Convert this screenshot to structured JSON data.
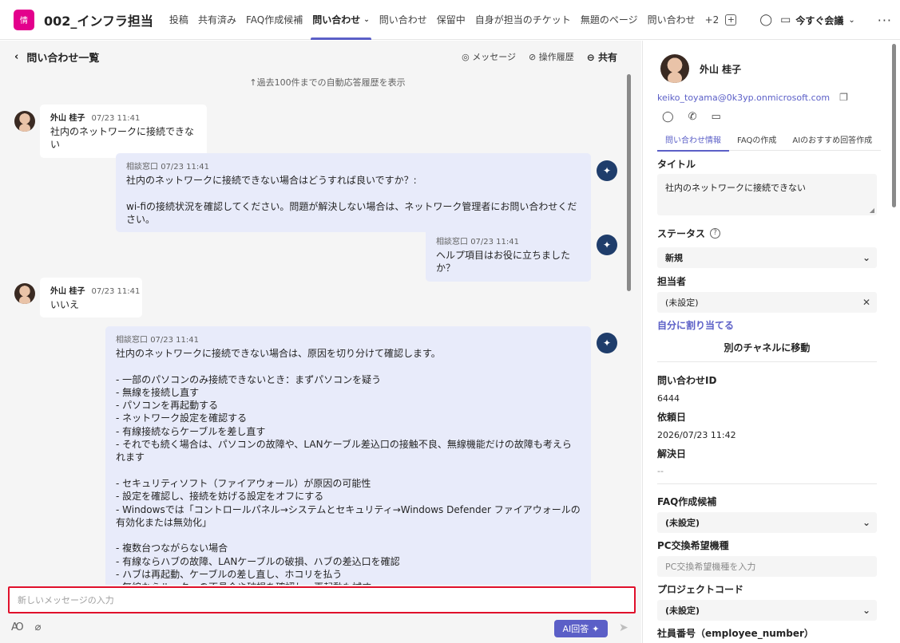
{
  "header": {
    "team_avatar": "情",
    "team_name": "002_インフラ担当",
    "tabs": [
      {
        "label": "投稿"
      },
      {
        "label": "共有済み"
      },
      {
        "label": "FAQ作成候補"
      },
      {
        "label": "問い合わせ",
        "active": true
      },
      {
        "label": "問い合わせ"
      },
      {
        "label": "保留中"
      },
      {
        "label": "自身が担当のチケット"
      },
      {
        "label": "無題のページ"
      },
      {
        "label": "問い合わせ"
      }
    ],
    "overflow_count": "+2",
    "meet_now": "今すぐ会議"
  },
  "chat": {
    "back_label": "問い合わせ一覧",
    "actions": {
      "message": "メッセージ",
      "history": "操作履歴",
      "share": "共有"
    },
    "history_link": "↑過去100件までの自動応答履歴を表示",
    "messages": [
      {
        "sender": "外山 桂子",
        "time": "07/23 11:41",
        "text": "社内のネットワークに接続できない"
      },
      {
        "sender": "相談窓口",
        "time": "07/23 11:41",
        "text": "社内のネットワークに接続できない場合はどうすれば良いですか？:\n\nwi-fiの接続状況を確認してください。問題が解決しない場合は、ネットワーク管理者にお問い合わせください。"
      },
      {
        "sender": "相談窓口",
        "time": "07/23 11:41",
        "text": "ヘルプ項目はお役に立ちましたか？"
      },
      {
        "sender": "外山 桂子",
        "time": "07/23 11:41",
        "text": "いいえ"
      },
      {
        "sender": "相談窓口",
        "time": "07/23 11:41",
        "text": "社内のネットワークに接続できない場合は、原因を切り分けて確認します。\n\n- 一部のパソコンのみ接続できないとき：まずパソコンを疑う\n- 無線を接続し直す\n- パソコンを再起動する\n- ネットワーク設定を確認する\n- 有線接続ならケーブルを差し直す\n- それでも続く場合は、パソコンの故障や、LANケーブル差込口の接触不良、無線機能だけの故障も考えられます\n\n- セキュリティソフト（ファイアウォール）が原因の可能性\n- 設定を確認し、接続を妨げる設定をオフにする\n- Windowsでは「コントロールパネル→システムとセキュリティ→Windows Defender ファイアウォールの有効化または無効化」\n\n- 複数台つながらない場合\n- 有線ならハブの故障、LANケーブルの破損、ハブの差込口を確認\n- ハブは再起動、ケーブルの差し直し、ホコリを払う\n- 無線ならルーターの不具合や破損を確認し、再起動も試す"
      }
    ],
    "composer_placeholder": "新しいメッセージの入力",
    "ai_button": "AI回答"
  },
  "panel": {
    "name": "外山 桂子",
    "email": "keiko_toyama@0k3yp.onmicrosoft.com",
    "tabs": [
      "問い合わせ情報",
      "FAQの作成",
      "AIのおすすめ回答作成"
    ],
    "title_label": "タイトル",
    "title_value": "社内のネットワークに接続できない",
    "status_label": "ステータス",
    "status_value": "新規",
    "assignee_label": "担当者",
    "assignee_value": "(未設定)",
    "assign_self": "自分に割り当てる",
    "move_channel": "別のチャネルに移動",
    "inquiry_id_label": "問い合わせID",
    "inquiry_id": "6444",
    "request_date_label": "依頼日",
    "request_date": "2026/07/23 11:42",
    "resolve_date_label": "解決日",
    "resolve_date": "--",
    "faq_label": "FAQ作成候補",
    "faq_value": "(未設定)",
    "pc_label": "PC交換希望機種",
    "pc_placeholder": "PC交換希望機種を入力",
    "project_label": "プロジェクトコード",
    "project_value": "(未設定)",
    "employee_label": "社員番号（employee_number）"
  },
  "colors": {
    "accent": "#5b5fc7",
    "bot_bubble": "#e8ebfa",
    "composer_border": "#e0102b",
    "team_avatar": "#e3008c"
  }
}
